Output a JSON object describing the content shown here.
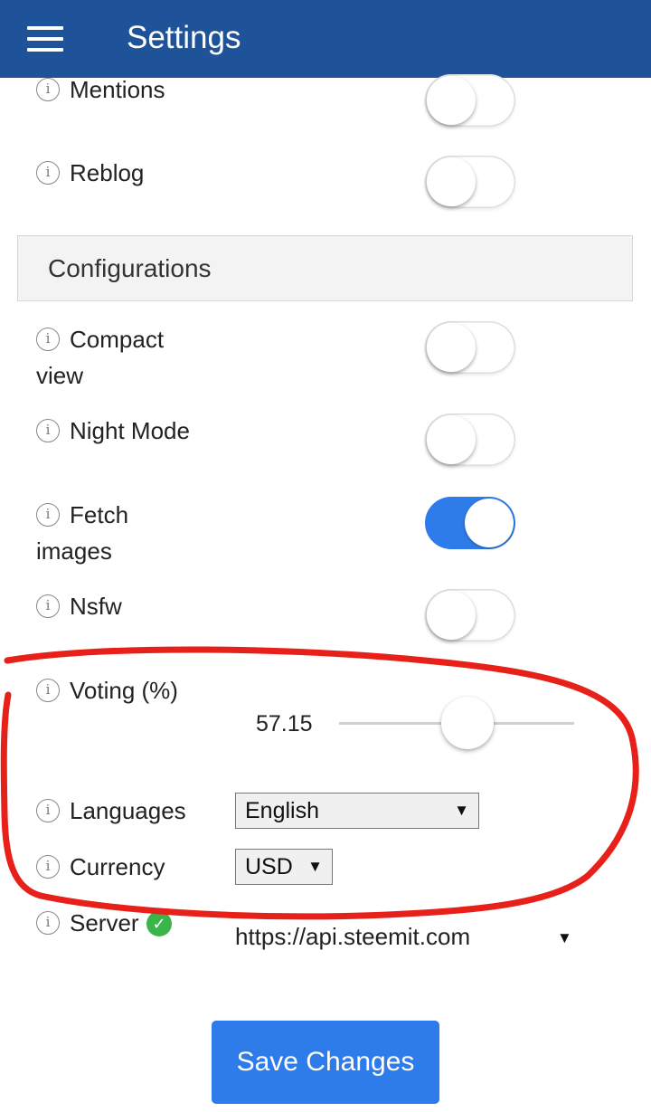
{
  "app_bar": {
    "title": "Settings",
    "menu_icon": "hamburger-menu-icon",
    "color": "#1f5399"
  },
  "notifications": [
    {
      "label": "Mentions",
      "enabled": false
    },
    {
      "label": "Reblog",
      "enabled": false
    }
  ],
  "configurations": {
    "title": "Configurations",
    "toggles": [
      {
        "label_line1": "Compact",
        "label_line2": "view",
        "enabled": false
      },
      {
        "label_line1": "Night Mode",
        "label_line2": "",
        "enabled": false
      },
      {
        "label_line1": "Fetch",
        "label_line2": "images",
        "enabled": true
      },
      {
        "label_line1": "Nsfw",
        "label_line2": "",
        "enabled": false
      }
    ],
    "voting": {
      "label": "Voting (%)",
      "value": "57.15",
      "percent": 57.15
    },
    "languages": {
      "label": "Languages",
      "selected": "English"
    },
    "currency": {
      "label": "Currency",
      "selected": "USD"
    },
    "server": {
      "label": "Server",
      "value": "https://api.steemit.com",
      "status_icon": "check-circle-icon"
    }
  },
  "info_icon_glyph": "i",
  "save_button": {
    "label": "Save Changes"
  },
  "colors": {
    "accent": "#2e7bea",
    "annotation": "#e8201a",
    "status_ok": "#3bb54a"
  }
}
